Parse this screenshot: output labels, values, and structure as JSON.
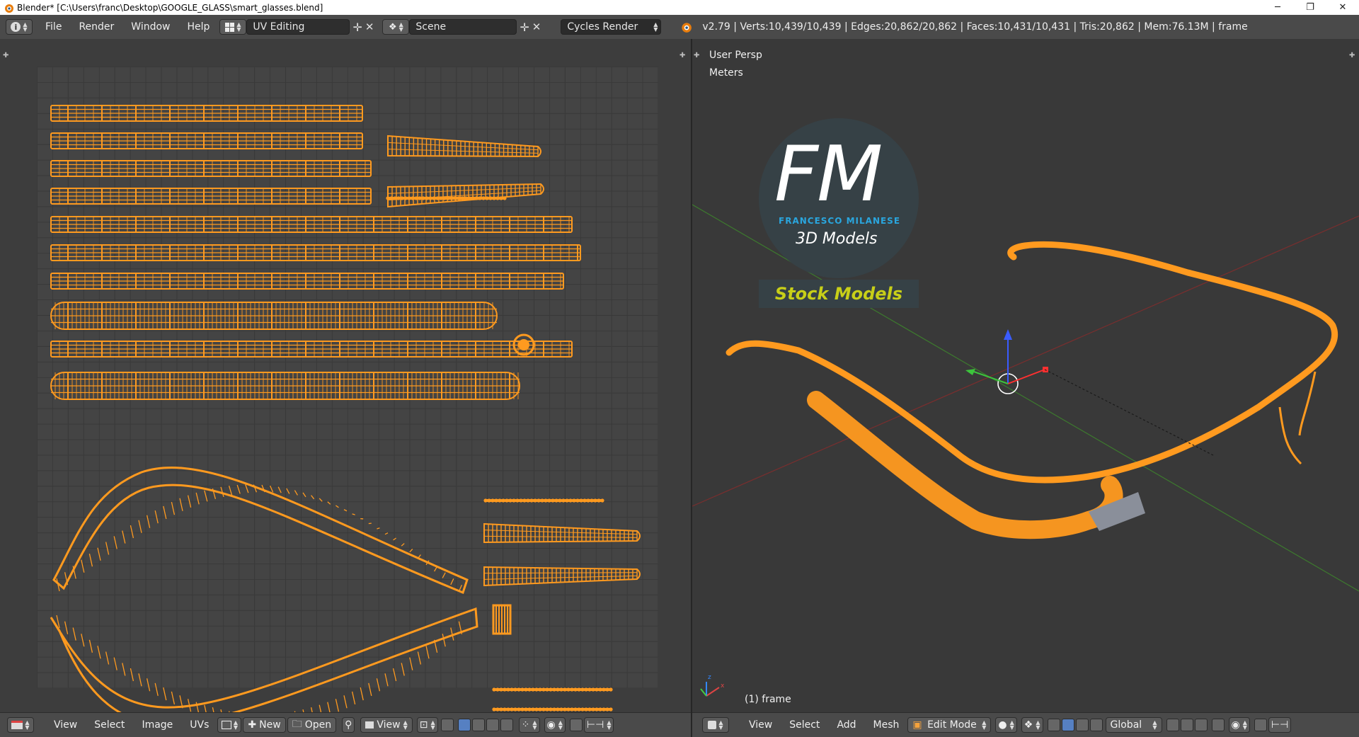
{
  "window": {
    "title": "Blender* [C:\\Users\\franc\\Desktop\\GOOGLE_GLASS\\smart_glasses.blend]",
    "minimize": "─",
    "maximize": "❐",
    "close": "✕"
  },
  "topbar": {
    "menus": [
      "File",
      "Render",
      "Window",
      "Help"
    ],
    "screen_layout": "UV Editing",
    "scene": "Scene",
    "engine": "Cycles Render",
    "stats": "v2.79 | Verts:10,439/10,439 | Edges:20,862/20,862 | Faces:10,431/10,431 | Tris:20,862 | Mem:76.13M | frame"
  },
  "uv_editor": {
    "header_menus": [
      "View",
      "Select",
      "Image",
      "UVs"
    ],
    "new_label": "New",
    "open_label": "Open",
    "view_label": "View",
    "uv_color": "#ff9a1f"
  },
  "viewport": {
    "persp_label": "User Persp",
    "units_label": "Meters",
    "object_label": "(1) frame",
    "header_menus": [
      "View",
      "Select",
      "Add",
      "Mesh"
    ],
    "mode": "Edit Mode",
    "orientation": "Global",
    "mesh_color": "#ff9a1f",
    "watermark": {
      "initials": "FM",
      "name": "FRANCESCO MILANESE",
      "subtitle": "3D Models",
      "badge": "Stock Models"
    }
  }
}
